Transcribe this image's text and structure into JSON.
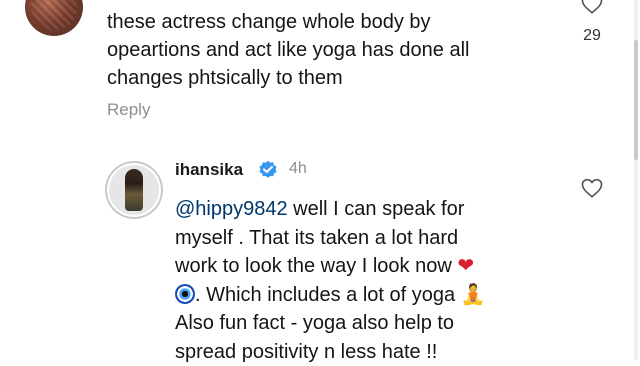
{
  "comment1": {
    "text_line1": "these actress change whole body by",
    "text_line2": "opeartions  and act like yoga has done all",
    "text_line3": "changes phtsically to them",
    "likes": "29",
    "reply_label": "Reply"
  },
  "comment2": {
    "username": "ihansika",
    "time": "4h",
    "mention": "@hippy9842",
    "line1_rest": " well I can speak for",
    "line2": "myself . That its taken a lot hard",
    "line3": "work to look the way I look now ",
    "line4_rest": ". Which includes a lot of yoga ",
    "line5": "Also fun fact - yoga also help to",
    "line6": "spread positivity n less hate !!",
    "emoji_heart": "❤",
    "emoji_yoga": "🧘"
  },
  "colors": {
    "mention": "#00376b",
    "verified": "#3897f0",
    "muted": "#8e8e8e"
  },
  "icons": {
    "like": "heart-outline-icon",
    "verified": "verified-badge-icon",
    "evil_eye": "nazar-amulet-emoji"
  }
}
